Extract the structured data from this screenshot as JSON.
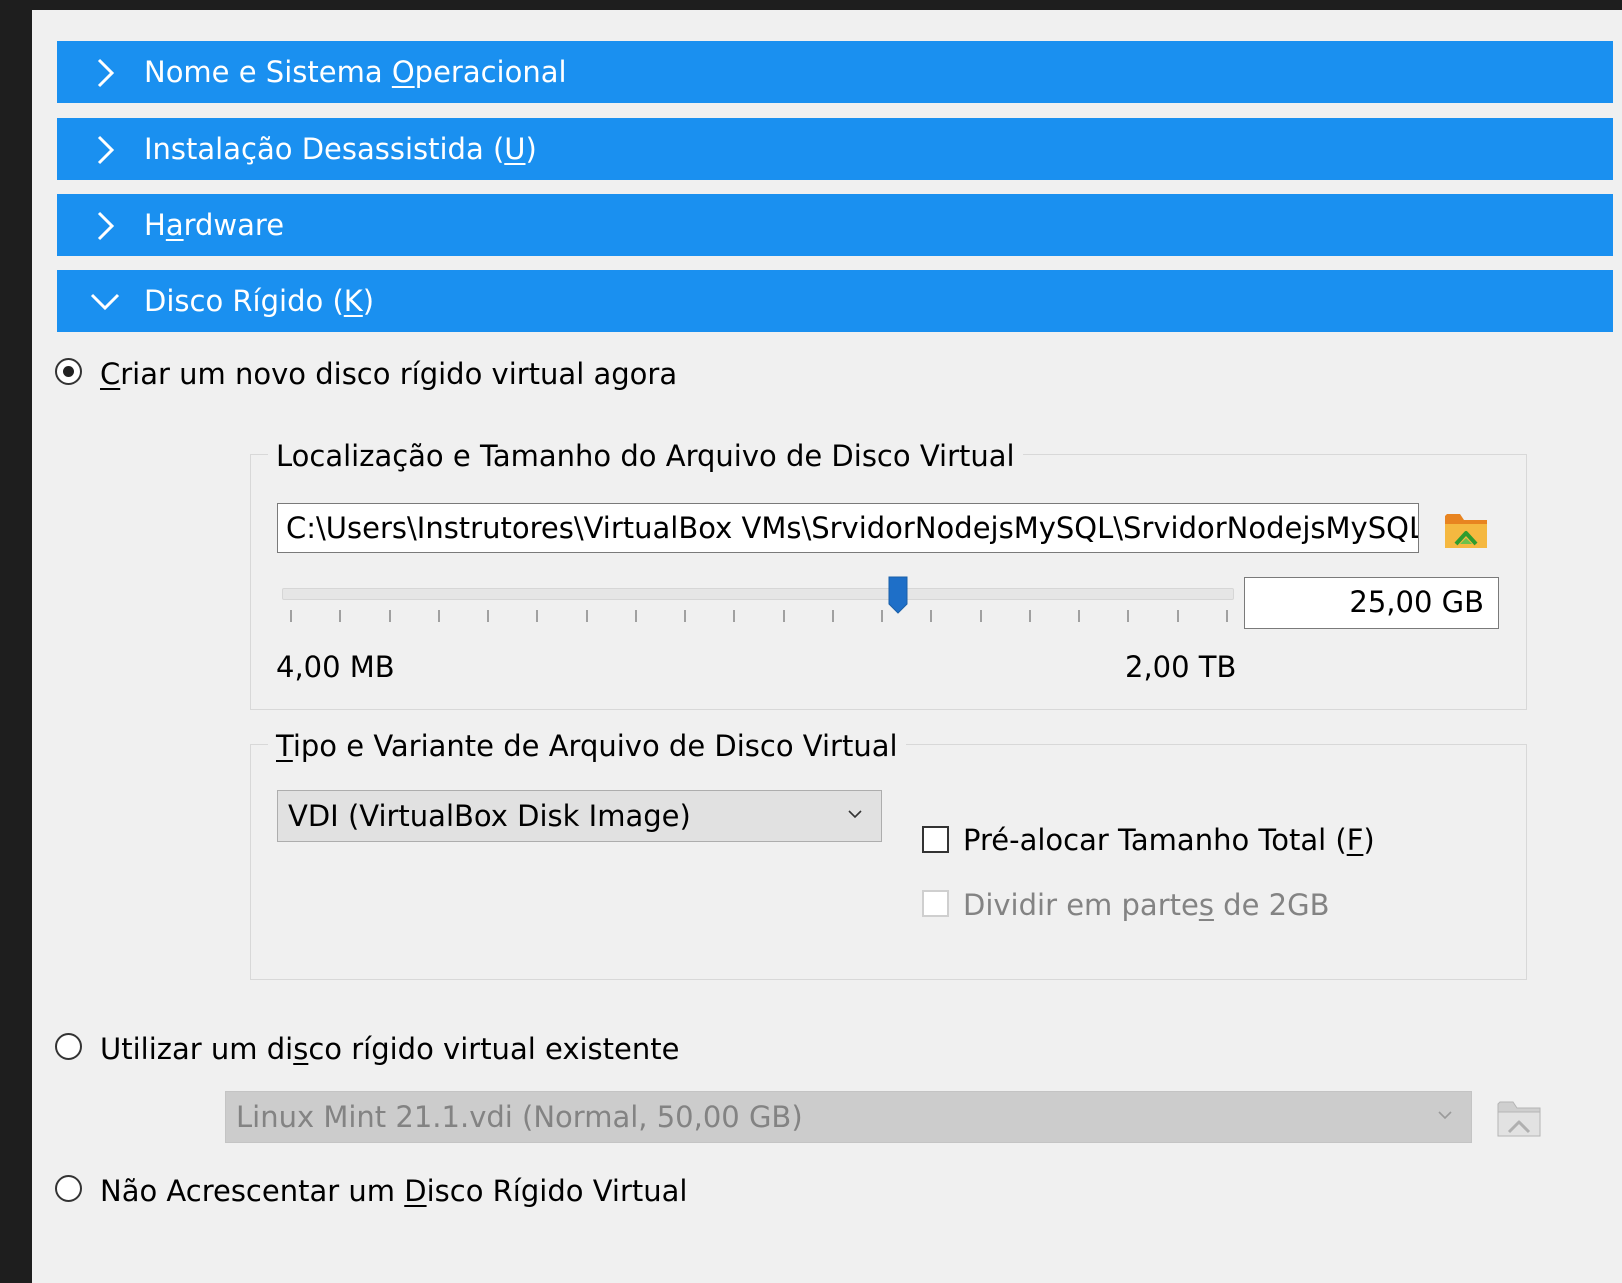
{
  "sections": [
    {
      "pre": "Nome e Sistema ",
      "mnemonic": "O",
      "post": "peracional",
      "expanded": false
    },
    {
      "pre": "Instalação Desassistida (",
      "mnemonic": "U",
      "post": ")",
      "expanded": false
    },
    {
      "pre": "H",
      "mnemonic": "a",
      "post": "rdware",
      "expanded": false
    },
    {
      "pre": "Disco Rígido (",
      "mnemonic": "K",
      "post": ")",
      "expanded": true
    }
  ],
  "disk_options": {
    "create_new": {
      "pre": "",
      "mnemonic": "C",
      "post": "riar um novo disco rígido virtual agora",
      "selected": true
    },
    "use_existing": {
      "pre": "Utilizar um di",
      "mnemonic": "s",
      "post": "co rígido virtual existente",
      "selected": false
    },
    "none": {
      "pre": "Não Acrescentar um ",
      "mnemonic": "D",
      "post": "isco Rígido Virtual",
      "selected": false
    }
  },
  "location_group": {
    "title": "Localização e Tamanho do Arquivo de Disco Virtual",
    "path_value": "C:\\Users\\Instrutores\\VirtualBox VMs\\SrvidorNodejsMySQL\\SrvidorNodejsMySQL.vdi",
    "size_value": "25,00 GB",
    "slider_min_label": "4,00 MB",
    "slider_max_label": "2,00 TB",
    "slider_fraction": 0.65,
    "tick_count": 20
  },
  "type_group": {
    "title_mnemonic": "T",
    "title_rest": "ipo e Variante de Arquivo de Disco Virtual",
    "format_selected": "VDI (VirtualBox Disk Image)",
    "prealloc": {
      "pre": "Pré-alocar Tamanho Total (",
      "mnemonic": "F",
      "post": ")",
      "checked": false,
      "enabled": true
    },
    "split": {
      "pre": "Dividir em parte",
      "mnemonic": "s",
      "post": " de 2GB",
      "checked": false,
      "enabled": false
    }
  },
  "existing_disk": {
    "selected": "Linux Mint 21.1.vdi (Normal, 50,00 GB)",
    "enabled": false
  },
  "colors": {
    "header_bg": "#1a90f0",
    "panel_bg": "#f0f0f0",
    "slider_thumb": "#1e6fc8",
    "folder_orange": "#f0a030"
  },
  "icons": {
    "collapsed": "chevron-right-icon",
    "expanded": "chevron-down-icon",
    "folder": "folder-open-icon"
  }
}
